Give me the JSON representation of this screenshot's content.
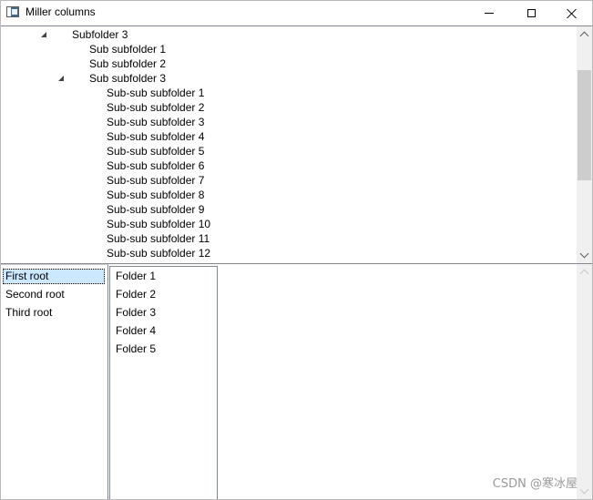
{
  "window": {
    "title": "Miller columns"
  },
  "icons": {
    "app": "window-app-icon",
    "minimize": "minimize-icon",
    "maximize": "maximize-icon",
    "close": "close-icon",
    "expanded": "expanded-triangle-icon",
    "scroll_up": "chevron-up-icon",
    "scroll_down": "chevron-down-icon"
  },
  "tree": {
    "rows": [
      {
        "label": "Subfolder 3",
        "expanded": true
      },
      {
        "label": "Sub subfolder 1",
        "expanded": false
      },
      {
        "label": "Sub subfolder 2",
        "expanded": false
      },
      {
        "label": "Sub subfolder 3",
        "expanded": true
      },
      {
        "label": "Sub-sub subfolder 1",
        "expanded": false
      },
      {
        "label": "Sub-sub subfolder 2",
        "expanded": false
      },
      {
        "label": "Sub-sub subfolder 3",
        "expanded": false
      },
      {
        "label": "Sub-sub subfolder 4",
        "expanded": false
      },
      {
        "label": "Sub-sub subfolder 5",
        "expanded": false
      },
      {
        "label": "Sub-sub subfolder 6",
        "expanded": false
      },
      {
        "label": "Sub-sub subfolder 7",
        "expanded": false
      },
      {
        "label": "Sub-sub subfolder 8",
        "expanded": false
      },
      {
        "label": "Sub-sub subfolder 9",
        "expanded": false
      },
      {
        "label": "Sub-sub subfolder 10",
        "expanded": false
      },
      {
        "label": "Sub-sub subfolder 11",
        "expanded": false
      },
      {
        "label": "Sub-sub subfolder 12",
        "expanded": false
      }
    ]
  },
  "miller": {
    "column1": {
      "items": [
        "First root",
        "Second root",
        "Third root"
      ],
      "selected": "First root"
    },
    "column2": {
      "items": [
        "Folder 1",
        "Folder 2",
        "Folder 3",
        "Folder 4",
        "Folder 5"
      ]
    }
  },
  "colors": {
    "selection_background": "#cce8ff",
    "border": "#828790",
    "scrollbar_track": "#f0f0f0",
    "scrollbar_thumb": "#cdcdcd"
  },
  "watermark": "CSDN @寒冰屋"
}
